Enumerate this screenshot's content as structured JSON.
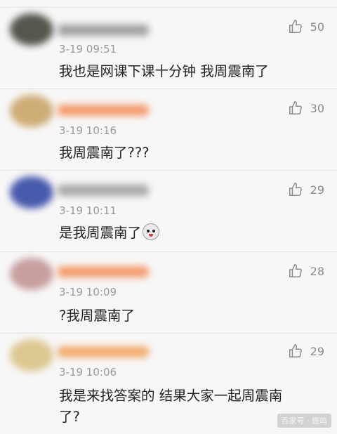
{
  "comments": [
    {
      "time": "3-19 09:51",
      "text": "我也是网课下课十分钟   我周震南了",
      "likes": "50",
      "avatar_color": "#3b3b30",
      "name_color": "#9a9a9a"
    },
    {
      "time": "3-19 10:16",
      "text": "我周震南了???",
      "likes": "30",
      "avatar_color": "#c8a060",
      "name_color": "#f39a6a"
    },
    {
      "time": "3-19 10:11",
      "text": "是我周震南了",
      "likes": "29",
      "avatar_color": "#2a3fa0",
      "name_color": "#9a9a9a"
    },
    {
      "time": "3-19 10:09",
      "text": "?我周震南了",
      "likes": "28",
      "avatar_color": "#c09090",
      "name_color": "#f39a6a"
    },
    {
      "time": "3-19 10:06",
      "text": "我是来找答案的 结果大家一起周震南了?",
      "likes": "29",
      "avatar_color": "#d8c080",
      "name_color": "#f3aa6a"
    }
  ],
  "watermark": "百家号 · 鹿鸣"
}
